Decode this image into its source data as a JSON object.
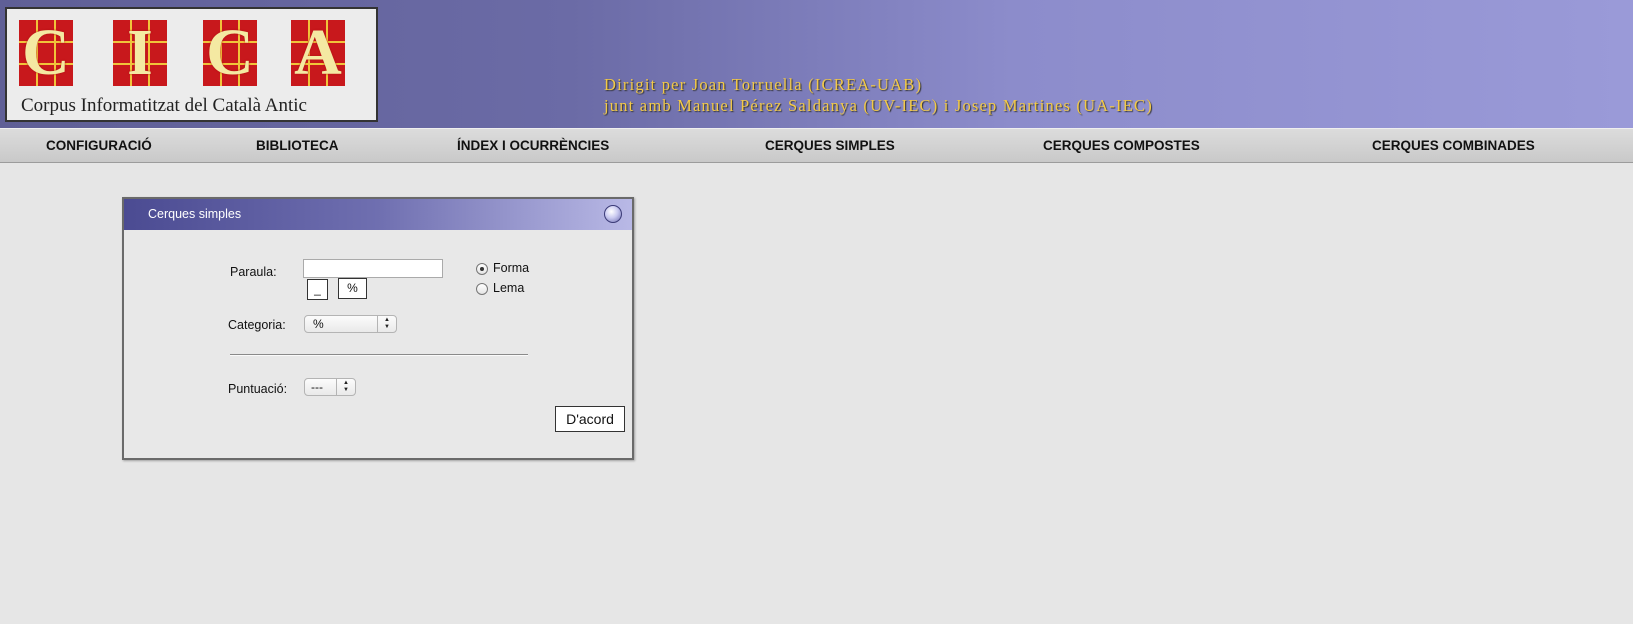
{
  "header": {
    "logo": {
      "letters": [
        "C",
        "I",
        "C",
        "A"
      ],
      "caption": "Corpus Informatitzat del Català Antic"
    },
    "credits_line1": "Dirigit per Joan Torruella (ICREA-UAB)",
    "credits_line2": "junt amb Manuel Pérez Saldanya (UV-IEC) i Josep Martines (UA-IEC)"
  },
  "nav": {
    "items": [
      {
        "label": "CONFIGURACIÓ"
      },
      {
        "label": "BIBLIOTECA"
      },
      {
        "label": "ÍNDEX I OCURRÈNCIES"
      },
      {
        "label": "CERQUES SIMPLES"
      },
      {
        "label": "CERQUES COMPOSTES"
      },
      {
        "label": "CERQUES COMBINADES"
      }
    ]
  },
  "panel": {
    "title": "Cerques simples",
    "paraula_label": "Paraula:",
    "paraula_value": "",
    "underscore_button": "_",
    "percent_button": "%",
    "radio_forma": {
      "label": "Forma",
      "checked": true
    },
    "radio_lema": {
      "label": "Lema",
      "checked": false
    },
    "categoria_label": "Categoria:",
    "categoria_value": "%",
    "puntuacio_label": "Puntuació:",
    "puntuacio_value": "---",
    "submit_label": "D'acord"
  },
  "colors": {
    "header_gradient_start": "#5f5f96",
    "header_gradient_end": "#9a9ad8",
    "credits_text": "#f2c949",
    "logo_tile": "#c8181c",
    "page_background": "#e6e6e6"
  }
}
